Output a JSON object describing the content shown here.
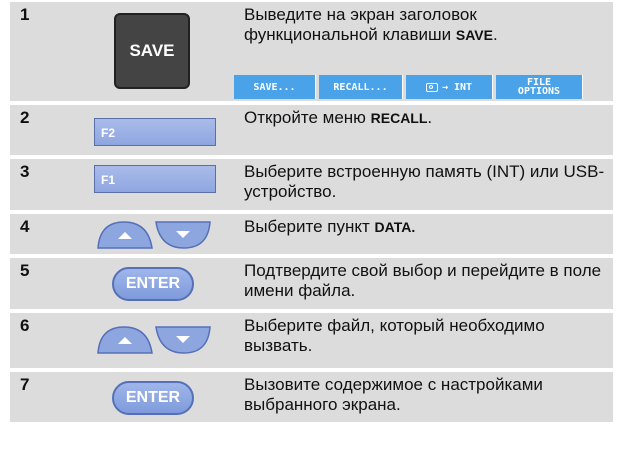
{
  "rows": [
    {
      "num": "1",
      "text": "Выведите на экран заголовок функциональной клавиши ",
      "bold": "SAVE",
      "after": "."
    },
    {
      "num": "2",
      "text": "Откройте меню ",
      "bold": "RECALL",
      "after": "."
    },
    {
      "num": "3",
      "text": "Выберите встроенную память (INT) или USB-устройство."
    },
    {
      "num": "4",
      "text": "Выберите пункт ",
      "bold": "DATA."
    },
    {
      "num": "5",
      "text": "Подтвердите свой выбор и перейдите в поле имени файла."
    },
    {
      "num": "6",
      "text": "Выберите файл, который необходимо вызвать."
    },
    {
      "num": "7",
      "text": "Вызовите содержимое с настройками выбранного экрана."
    }
  ],
  "keys": {
    "save": "SAVE",
    "f2": "F2",
    "f1": "F1",
    "enter": "ENTER"
  },
  "softkeys": {
    "save": "SAVE...",
    "recall": "RECALL...",
    "copy_int": "→ INT",
    "file_line1": "FILE",
    "file_line2": "OPTIONS"
  },
  "icons": {
    "camera": "camera-icon",
    "arrow_up": "arrow-up-icon",
    "arrow_down": "arrow-down-icon"
  },
  "colors": {
    "row_bg": "#dcdcdc",
    "softkey_bg": "#4aa3e8",
    "key_blue": "#8ea6e0",
    "save_key": "#444444"
  }
}
